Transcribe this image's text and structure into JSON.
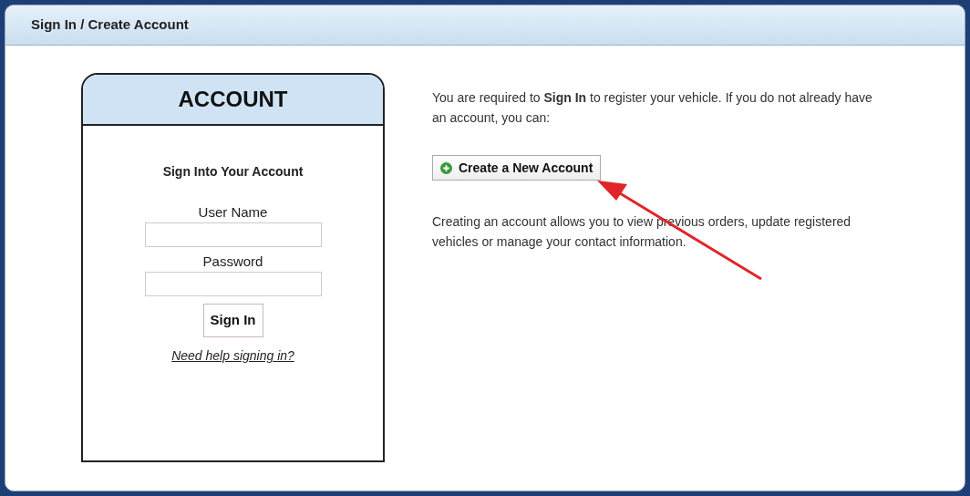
{
  "panel": {
    "title": "Sign In / Create Account"
  },
  "account_box": {
    "title": "ACCOUNT",
    "heading": "Sign Into Your Account",
    "fields": [
      {
        "label": "User Name"
      },
      {
        "label": "Password"
      }
    ],
    "sign_in_button": "Sign In",
    "help_link": "Need help signing in?"
  },
  "intro_text": "You are required to **Sign In** to register your vehicle. If you do not already have an account, you can:",
  "create_button": "Create a New Account",
  "info_text": "Creating an account allows you to view previous orders, update registered vehicles or manage your contact information."
}
